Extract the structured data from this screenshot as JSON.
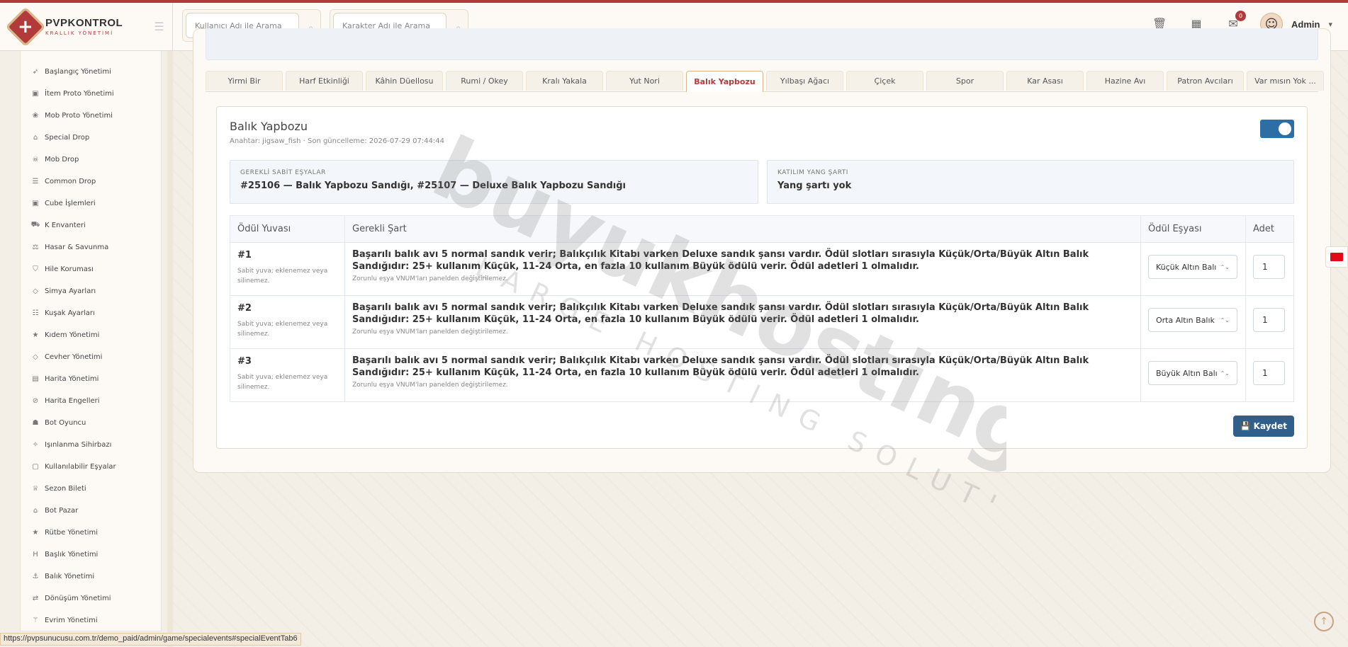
{
  "brand": {
    "name": "PVPKONTROL",
    "subtitle": "KRALLIK YÖNETİMİ"
  },
  "header": {
    "search_user_placeholder": "Kullanıcı Adı ile Arama",
    "search_char_placeholder": "Karakter Adı ile Arama",
    "mail_badge": "0",
    "admin_name": "Admin"
  },
  "sidebar": {
    "items": [
      {
        "label": "Başlangıç Yönetimi",
        "icon": "rocket-icon"
      },
      {
        "label": "İtem Proto Yönetimi",
        "icon": "cube-icon"
      },
      {
        "label": "Mob Proto Yönetimi",
        "icon": "paw-icon"
      },
      {
        "label": "Special Drop",
        "icon": "gift-icon"
      },
      {
        "label": "Mob Drop",
        "icon": "skull-icon"
      },
      {
        "label": "Common Drop",
        "icon": "list-icon"
      },
      {
        "label": "Cube İşlemleri",
        "icon": "cube-icon"
      },
      {
        "label": "K Envanteri",
        "icon": "cart-icon"
      },
      {
        "label": "Hasar & Savunma",
        "icon": "scale-icon"
      },
      {
        "label": "Hile Koruması",
        "icon": "shield-icon"
      },
      {
        "label": "Simya Ayarları",
        "icon": "gem-icon"
      },
      {
        "label": "Kuşak Ayarları",
        "icon": "sliders-icon"
      },
      {
        "label": "Kıdem Yönetimi",
        "icon": "star-icon"
      },
      {
        "label": "Cevher Yönetimi",
        "icon": "gem-icon"
      },
      {
        "label": "Harita Yönetimi",
        "icon": "map-icon"
      },
      {
        "label": "Harita Engelleri",
        "icon": "ban-icon"
      },
      {
        "label": "Bot Oyuncu",
        "icon": "robot-icon"
      },
      {
        "label": "Işınlanma Sihirbazı",
        "icon": "magic-icon"
      },
      {
        "label": "Kullanılabilir Eşyalar",
        "icon": "box-icon"
      },
      {
        "label": "Sezon Bileti",
        "icon": "trophy-icon"
      },
      {
        "label": "Bot Pazar",
        "icon": "shop-icon"
      },
      {
        "label": "Rütbe Yönetimi",
        "icon": "star-icon"
      },
      {
        "label": "Başlık Yönetimi",
        "icon": "heading-icon"
      },
      {
        "label": "Balık Yönetimi",
        "icon": "anchor-icon"
      },
      {
        "label": "Dönüşüm Yönetimi",
        "icon": "shuffle-icon"
      },
      {
        "label": "Evrim Yönetimi",
        "icon": "wand-icon"
      }
    ]
  },
  "tabs": [
    {
      "label": "Yirmi Bir"
    },
    {
      "label": "Harf Etkinliği"
    },
    {
      "label": "Kâhin Düellosu"
    },
    {
      "label": "Rumi / Okey"
    },
    {
      "label": "Kralı Yakala"
    },
    {
      "label": "Yut Nori"
    },
    {
      "label": "Balık Yapbozu",
      "active": true
    },
    {
      "label": "Yılbaşı Ağacı"
    },
    {
      "label": "Çiçek"
    },
    {
      "label": "Spor"
    },
    {
      "label": "Kar Asası"
    },
    {
      "label": "Hazine Avı"
    },
    {
      "label": "Patron Avcıları"
    },
    {
      "label": "Var mısın Yok ..."
    }
  ],
  "event": {
    "title": "Balık Yapbozu",
    "meta": "Anahtar: jigsaw_fish · Son güncelleme: 2026-07-29 07:44:44",
    "enabled": true,
    "required_items_label": "GEREKLİ SABİT EŞYALAR",
    "required_items_value": "#25106 — Balık Yapbozu Sandığı, #25107 — Deluxe Balık Yapbozu Sandığı",
    "yang_label": "KATILIM YANG ŞARTI",
    "yang_value": "Yang şartı yok"
  },
  "table": {
    "headers": [
      "Ödül Yuvası",
      "Gerekli Şart",
      "Ödül Eşyası",
      "Adet"
    ],
    "rows": [
      {
        "slot": "#1",
        "slot_note": "Sabit yuva; eklenemez veya silinemez.",
        "condition": "Başarılı balık avı 5 normal sandık verir; Balıkçılık Kitabı varken Deluxe sandık şansı vardır. Ödül slotları sırasıyla Küçük/Orta/Büyük Altın Balık Sandığıdır: 25+ kullanım Küçük, 11-24 Orta, en fazla 10 kullanım Büyük ödülü verir. Ödül adetleri 1 olmalıdır.",
        "condition_note": "Zorunlu eşya VNUM'ları panelden değiştirilemez.",
        "item": "Küçük Altın Balı",
        "qty": "1"
      },
      {
        "slot": "#2",
        "slot_note": "Sabit yuva; eklenemez veya silinemez.",
        "condition": "Başarılı balık avı 5 normal sandık verir; Balıkçılık Kitabı varken Deluxe sandık şansı vardır. Ödül slotları sırasıyla Küçük/Orta/Büyük Altın Balık Sandığıdır: 25+ kullanım Küçük, 11-24 Orta, en fazla 10 kullanım Büyük ödülü verir. Ödül adetleri 1 olmalıdır.",
        "condition_note": "Zorunlu eşya VNUM'ları panelden değiştirilemez.",
        "item": "Orta Altın Balık",
        "qty": "1"
      },
      {
        "slot": "#3",
        "slot_note": "Sabit yuva; eklenemez veya silinemez.",
        "condition": "Başarılı balık avı 5 normal sandık verir; Balıkçılık Kitabı varken Deluxe sandık şansı vardır. Ödül slotları sırasıyla Küçük/Orta/Büyük Altın Balık Sandığıdır: 25+ kullanım Küçük, 11-24 Orta, en fazla 10 kullanım Büyük ödülü verir. Ödül adetleri 1 olmalıdır.",
        "condition_note": "Zorunlu eşya VNUM'ları panelden değiştirilemez.",
        "item": "Büyük Altın Balı",
        "qty": "1"
      }
    ]
  },
  "save_label": "Kaydet",
  "watermark": {
    "line1": "buyukhosting",
    "line2": "LARGE HOSTING SOLUTIONS"
  },
  "status_url": "https://pvpsunucusu.com.tr/demo_paid/admin/game/specialevents#specialEventTab6",
  "colors": {
    "accent": "#b33a3a",
    "primary": "#2d6ea5",
    "save": "#2f5f8a"
  }
}
